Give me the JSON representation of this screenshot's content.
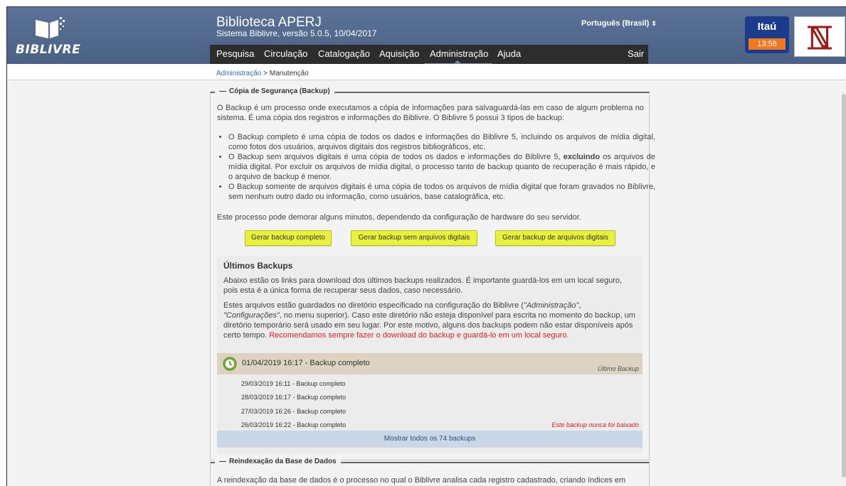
{
  "header": {
    "logo_text": "BIBLIVRE",
    "library_name": "Biblioteca APERJ",
    "system_version": "Sistema Biblivre, versão 5.0.5, 10/04/2017",
    "language": "Português (Brasil)",
    "bank_name": "Itaú",
    "clock": "13:58"
  },
  "menu": {
    "items": [
      "Pesquisa",
      "Circulação",
      "Catalogação",
      "Aquisição",
      "Administração",
      "Ajuda"
    ],
    "active": "Administração",
    "logout": "Sair"
  },
  "breadcrumb": {
    "parent": "Administração",
    "separator": " > ",
    "current": "Manutenção"
  },
  "backup_section": {
    "legend": "Cópia de Segurança (Backup)",
    "intro": "O Backup é um processo onde executamos a cópia de informações para salvaguardá-las em caso de algum problema no sistema. É uma cópia dos registros e informações do Biblivre. O Biblivre 5 possui 3 tipos de backup:",
    "bullet1": "O Backup completo é uma cópia de todos os dados e informações do Biblivre 5, incluindo os arquivos de mídia digital, como fotos dos usuários, arquivos digitais dos registros bibliográficos, etc.",
    "bullet2_a": "O Backup sem arquivos digitais é uma cópia de todos os dados e informações do Biblivre 5, ",
    "bullet2_bold": "excluindo",
    "bullet2_b": " os arquivos de mídia digital. Por excluir os arquivos de mídia digital, o processo tanto de backup quanto de recuperação é mais rápido, e o arquivo de backup é menor.",
    "bullet3": "O Backup somente de arquivos digitais é uma cópia de todos os arquivos de mídia digital que foram gravados no Biblivre, sem nenhum outro dado ou informação, como usuários, base catalográfica, etc.",
    "note": "Este processo pode demorar alguns minutos, dependendo da configuração de hardware do seu servidor.",
    "buttons": {
      "full": "Gerar backup completo",
      "no_digital": "Gerar backup sem arquivos digitais",
      "digital_only": "Gerar backup de arquivos digitais"
    }
  },
  "last_backups": {
    "title": "Últimos Backups",
    "para1": "Abaixo estão os links para download dos últimos backups realizados. É importante guardá-los em um local seguro, pois esta é a única forma de recuperar seus dados, caso necessário.",
    "para2_a": "Estes arquivos estão guardados no diretório especificado na configuração do Biblivre (",
    "para2_admin": "\"Administração\"",
    "para2_sep": ", ",
    "para2_config": "\"Configurações\"",
    "para2_b": ", no menu superior). Caso este diretório não esteja disponível para escrita no momento do backup, um diretório temporário será usado em seu lugar. Por este motivo, alguns dos backups podem não estar disponíveis após certo tempo. ",
    "para2_red": "Recomendamos sempre fazer o download do backup e guardá-lo em um local seguro.",
    "latest": "01/04/2019 16:17 - Backup completo",
    "latest_tag": "Último Backup",
    "rows": [
      "29/03/2019 16:11 - Backup completo",
      "28/03/2019 16:17 - Backup completo",
      "27/03/2019 16:26 - Backup completo",
      "26/03/2019 16:22 - Backup completo"
    ],
    "never_downloaded": "Este backup nunca foi baixado",
    "show_all": "Mostrar todos os 74 backups"
  },
  "reindex_section": {
    "legend": "Reindexação da Base de Dados",
    "text": "A reindexação da base de dados é o processo no qual o Biblivre analisa cada registro cadastrado, criando índices em"
  },
  "colors": {
    "header": "#4f6a8f",
    "menubar": "#2d2d2d",
    "button": "#e8f23a",
    "latest_row": "#dcd3c1",
    "show_all": "#c9d7e6",
    "warning": "#e02020"
  }
}
